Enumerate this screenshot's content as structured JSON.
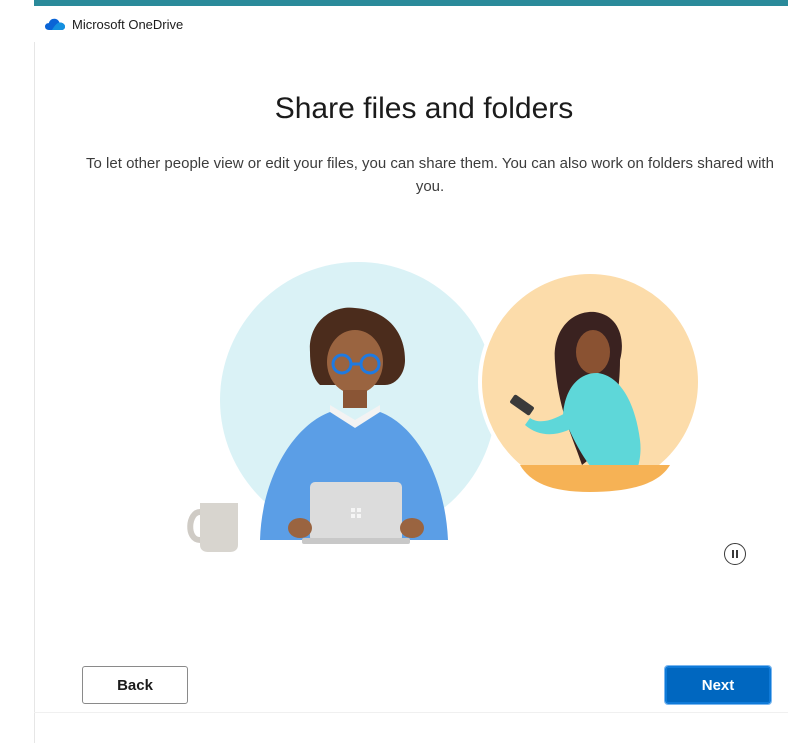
{
  "window": {
    "app_title": "Microsoft OneDrive"
  },
  "content": {
    "heading": "Share files and folders",
    "subtitle": "To let other people view or edit your files, you can share them. You can also work on folders shared with you."
  },
  "controls": {
    "pause_icon": "pause-circle-icon",
    "back_label": "Back",
    "next_label": "Next"
  },
  "colors": {
    "accent": "#0067c0",
    "onedrive_blue": "#0a64d6",
    "illustration_bg_left": "#d9f1f5",
    "illustration_bg_right": "#fbd9a8"
  }
}
